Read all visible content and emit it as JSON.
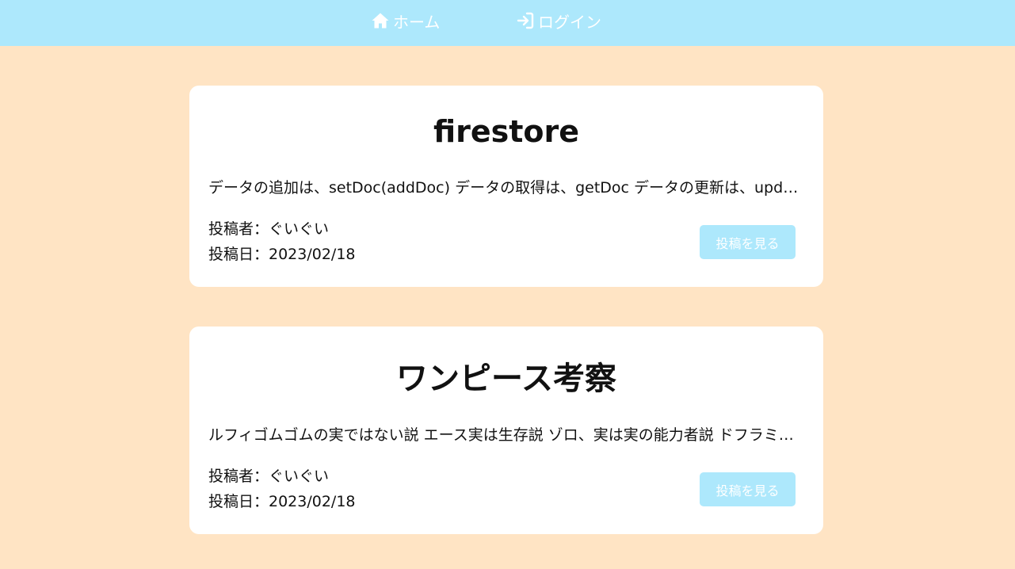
{
  "nav": {
    "items": [
      {
        "label": "ホーム",
        "icon": "home-icon"
      },
      {
        "label": "ログイン",
        "icon": "login-icon"
      }
    ]
  },
  "colors": {
    "background": "#ffe4c4",
    "nav_background": "#ade8fc",
    "card_background": "#ffffff",
    "button_background": "#ade8fc",
    "button_text": "#ffffff"
  },
  "posts": [
    {
      "title": "firestore",
      "excerpt": "データの追加は、setDoc(addDoc) データの取得は、getDoc データの更新は、updateDoc",
      "author_line": "投稿者：ぐいぐい",
      "date_line": "投稿日：2023/02/18",
      "button_label": "投稿を見る"
    },
    {
      "title": "ワンピース考察",
      "excerpt": "ルフィゴムゴムの実ではない説 エース実は生存説 ゾロ、実は実の能力者説 ドフラミンゴ",
      "author_line": "投稿者：ぐいぐい",
      "date_line": "投稿日：2023/02/18",
      "button_label": "投稿を見る"
    }
  ]
}
